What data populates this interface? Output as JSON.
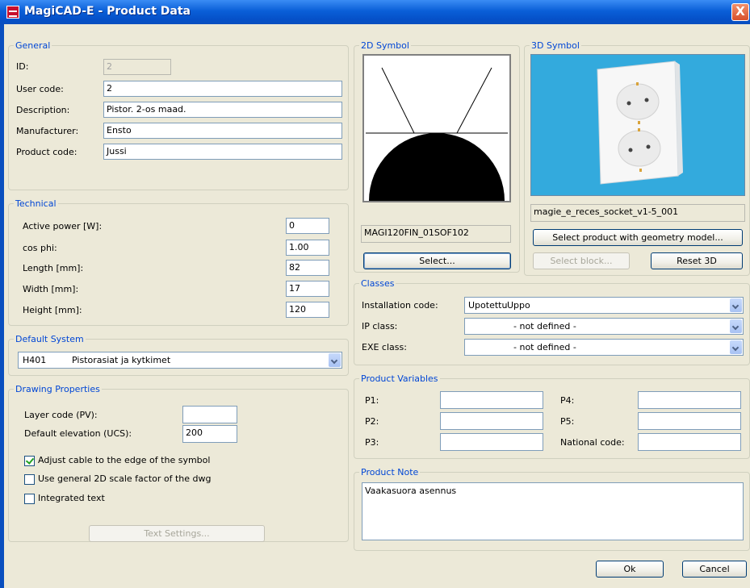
{
  "window": {
    "title": "MagiCAD-E - Product Data",
    "close_label": "X"
  },
  "general": {
    "legend": "General",
    "id_label": "ID:",
    "id_value": "2",
    "user_code_label": "User code:",
    "user_code_value": "2",
    "description_label": "Description:",
    "description_value": "Pistor. 2-os maad.",
    "manufacturer_label": "Manufacturer:",
    "manufacturer_value": "Ensto",
    "product_code_label": "Product code:",
    "product_code_value": "Jussi"
  },
  "technical": {
    "legend": "Technical",
    "rows": [
      {
        "label": "Active power [W]:",
        "value": "0"
      },
      {
        "label": "cos phi:",
        "value": "1.00"
      },
      {
        "label": "Length [mm]:",
        "value": "82"
      },
      {
        "label": "Width [mm]:",
        "value": "17"
      },
      {
        "label": "Height [mm]:",
        "value": "120"
      }
    ]
  },
  "default_system": {
    "legend": "Default System",
    "code": "H401",
    "name": "Pistorasiat ja kytkimet"
  },
  "drawing": {
    "legend": "Drawing Properties",
    "layer_code_label": "Layer code (PV):",
    "layer_code_value": "",
    "elevation_label": "Default elevation (UCS):",
    "elevation_value": "200",
    "checkboxes": [
      {
        "label": "Adjust cable to the edge of the symbol",
        "checked": true
      },
      {
        "label": "Use general 2D scale factor of the dwg",
        "checked": false
      },
      {
        "label": "Integrated text",
        "checked": false
      }
    ],
    "text_settings_label": "Text Settings..."
  },
  "symbol2d": {
    "legend": "2D Symbol",
    "name": "MAGI120FIN_01SOF102",
    "select_label": "Select..."
  },
  "symbol3d": {
    "legend": "3D Symbol",
    "name": "magie_e_reces_socket_v1-5_001",
    "select_geometry_label": "Select product with geometry model...",
    "select_block_label": "Select block...",
    "reset_label": "Reset 3D",
    "preview_bg": "#33aadd"
  },
  "classes": {
    "legend": "Classes",
    "rows": [
      {
        "label": "Installation code:",
        "code": "Upotettu",
        "value": "Uppo"
      },
      {
        "label": "IP class:",
        "code": "",
        "value": "- not defined -"
      },
      {
        "label": "EXE class:",
        "code": "",
        "value": "- not defined -"
      }
    ]
  },
  "variables": {
    "legend": "Product Variables",
    "left": [
      {
        "label": "P1:",
        "value": ""
      },
      {
        "label": "P2:",
        "value": ""
      },
      {
        "label": "P3:",
        "value": ""
      }
    ],
    "right": [
      {
        "label": "P4:",
        "value": ""
      },
      {
        "label": "P5:",
        "value": ""
      },
      {
        "label": "National code:",
        "value": ""
      }
    ]
  },
  "note": {
    "legend": "Product Note",
    "text": "Vaakasuora asennus"
  },
  "footer": {
    "ok_label": "Ok",
    "cancel_label": "Cancel"
  }
}
